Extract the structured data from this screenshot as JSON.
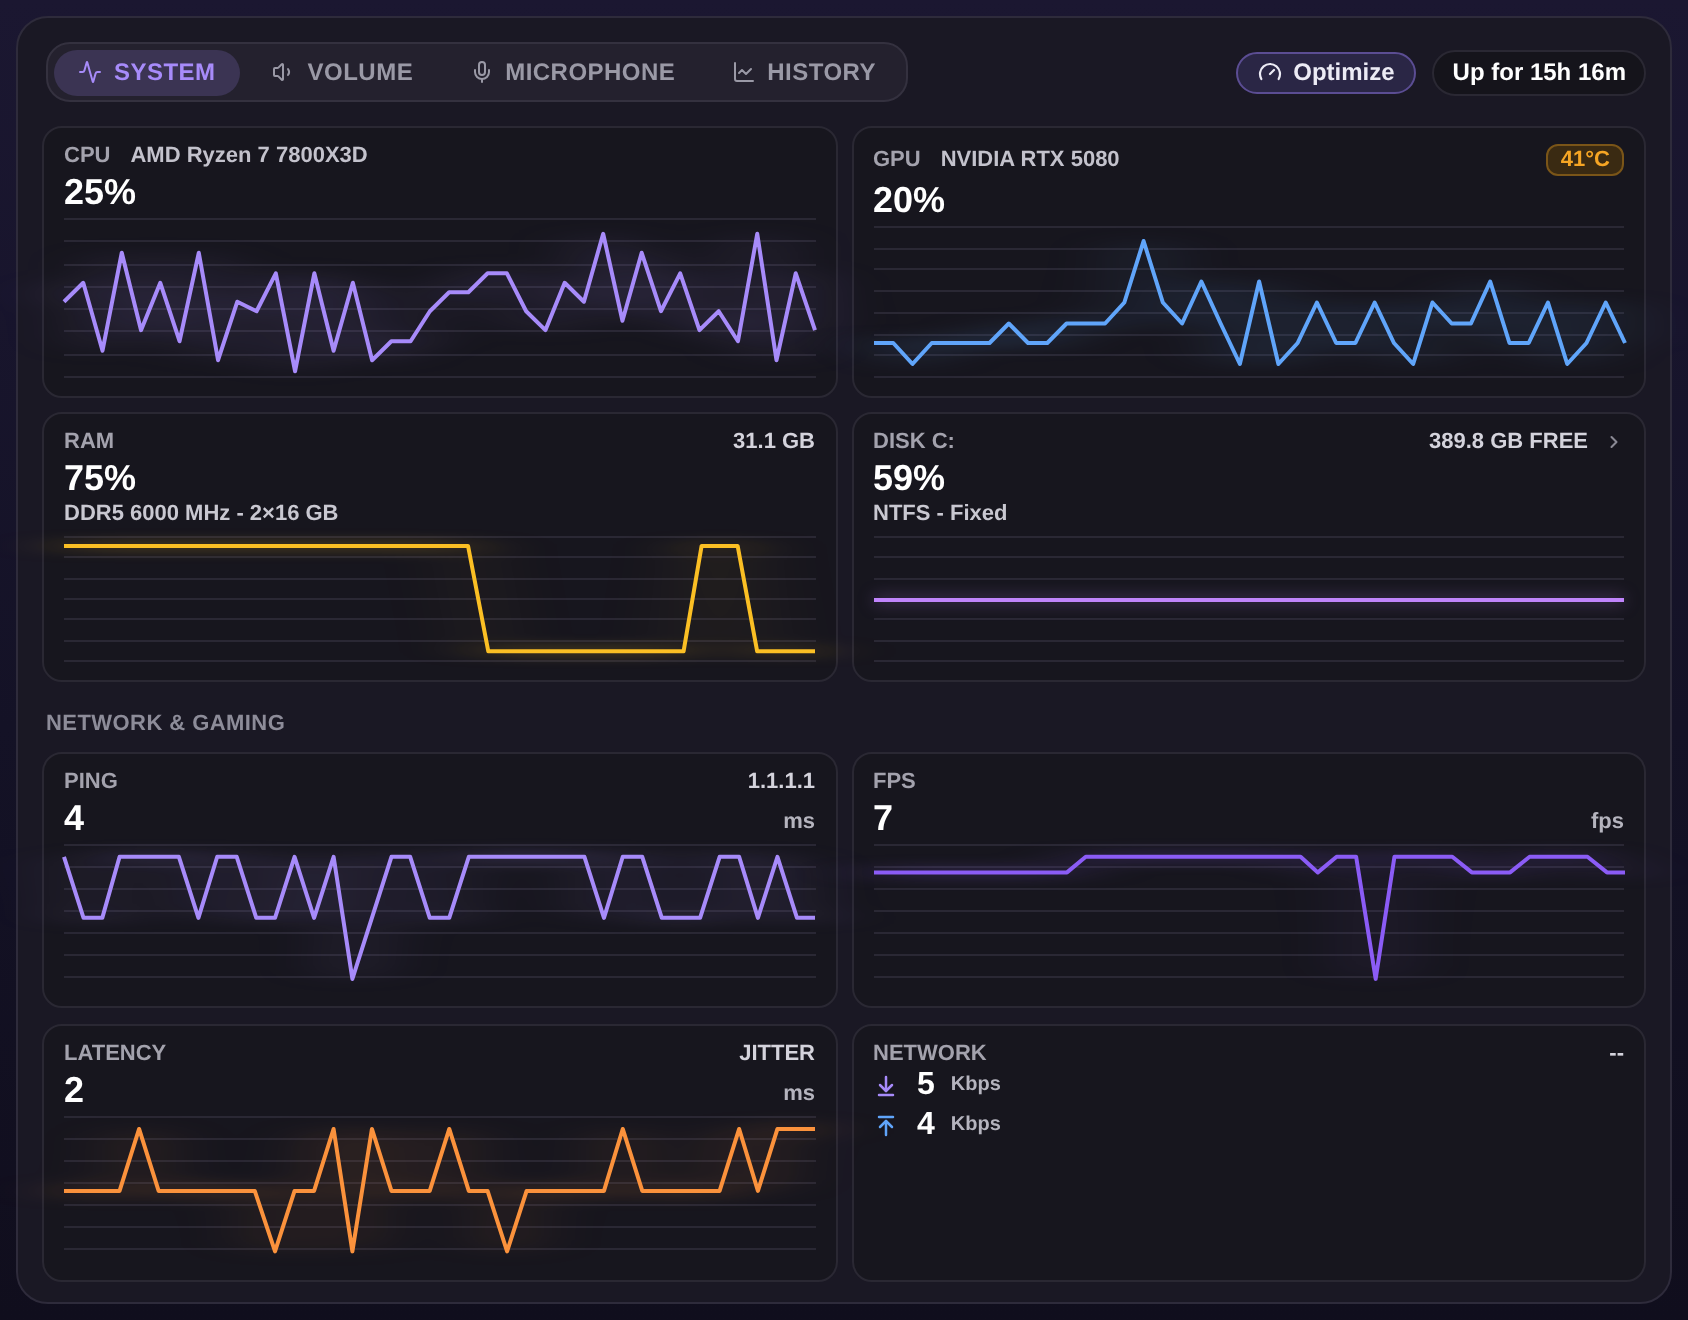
{
  "tabs": [
    {
      "label": "SYSTEM",
      "selected": true
    },
    {
      "label": "VOLUME",
      "selected": false
    },
    {
      "label": "MICROPHONE",
      "selected": false
    },
    {
      "label": "HISTORY",
      "selected": false
    }
  ],
  "optimize_button": {
    "label": "Optimize"
  },
  "uptime": "Up for 15h 16m",
  "system_cards": [
    {
      "kind": "graph",
      "label": "CPU",
      "model": "AMD Ryzen 7 7800X3D",
      "value": "25%",
      "color": "#a78bfa"
    },
    {
      "kind": "graph",
      "label": "GPU",
      "model": "NVIDIA RTX 5080",
      "badge": "41°C",
      "value": "20%",
      "color": "#60a5fa"
    },
    {
      "kind": "graph",
      "label": "RAM",
      "info": "31.1 GB",
      "value": "75%",
      "detail": "DDR5 6000 MHz - 2×16 GB",
      "color": "#fbbf24"
    },
    {
      "kind": "drive",
      "label": "DISK C:",
      "info": "389.8 GB FREE",
      "value": "59%",
      "detail": "NTFS - Fixed",
      "color": "#c084fc"
    }
  ],
  "section_title": "NETWORK & GAMING",
  "network_cards": [
    {
      "kind": "graph",
      "label": "PING",
      "info": "1.1.1.1",
      "value": "4",
      "unit": "ms",
      "color": "#a78bfa"
    },
    {
      "kind": "graph",
      "label": "FPS",
      "value": "7",
      "unit": "fps",
      "color": "#8b5cf6"
    },
    {
      "kind": "graph",
      "label": "LATENCY",
      "info": "JITTER",
      "value": "2",
      "unit": "ms",
      "color": "#fb923c"
    },
    {
      "kind": "rates",
      "label": "NETWORK",
      "info": "--",
      "rates": [
        {
          "value": "5",
          "unit": "Kbps"
        },
        {
          "value": "4",
          "unit": "Kbps"
        }
      ]
    }
  ]
}
